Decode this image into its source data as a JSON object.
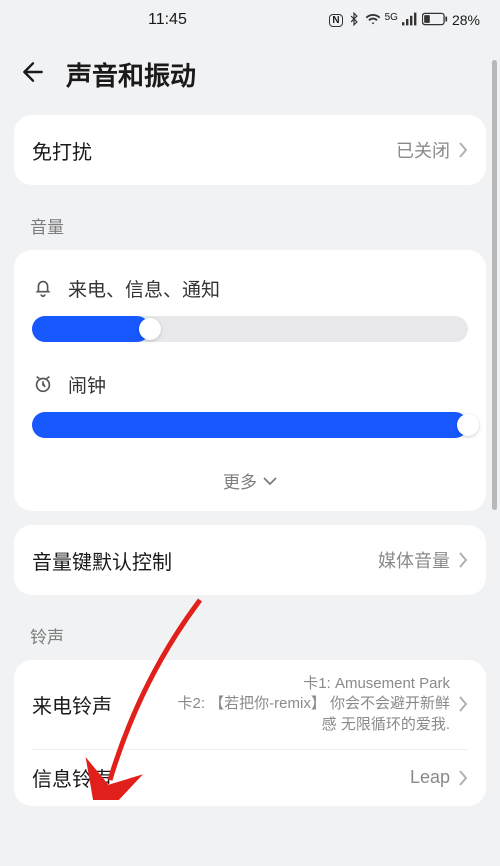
{
  "status": {
    "time": "11:45",
    "battery_pct": "28%"
  },
  "header": {
    "title": "声音和振动"
  },
  "dnd": {
    "label": "免打扰",
    "value": "已关闭"
  },
  "volume": {
    "section_label": "音量",
    "ring": {
      "label": "来电、信息、通知",
      "level_pct": 27
    },
    "alarm": {
      "label": "闹钟",
      "level_pct": 100
    },
    "more_label": "更多"
  },
  "volume_key": {
    "label": "音量键默认控制",
    "value": "媒体音量"
  },
  "ringtones": {
    "section_label": "铃声",
    "incoming": {
      "label": "来电铃声",
      "sim1": "卡1: Amusement Park",
      "sim2": "卡2: 【若把你-remix】 你会不会避开新鲜感 无限循环的爱我."
    },
    "message": {
      "label": "信息铃声",
      "value": "Leap"
    }
  }
}
